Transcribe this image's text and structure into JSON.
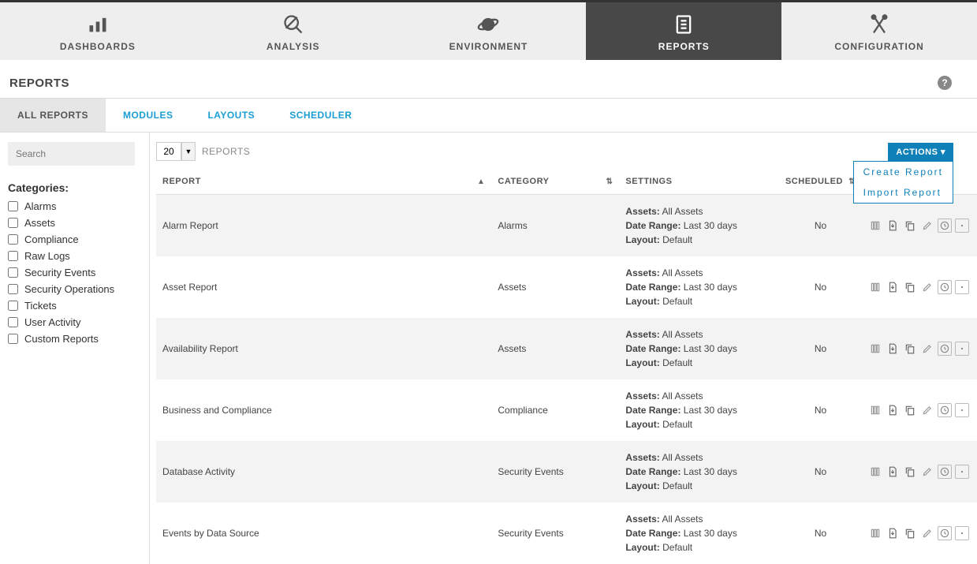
{
  "mainnav": {
    "items": [
      {
        "label": "DASHBOARDS"
      },
      {
        "label": "ANALYSIS"
      },
      {
        "label": "ENVIRONMENT"
      },
      {
        "label": "REPORTS"
      },
      {
        "label": "CONFIGURATION"
      }
    ],
    "active_index": 3
  },
  "page_title": "REPORTS",
  "help_glyph": "?",
  "subnav": {
    "items": [
      {
        "label": "ALL REPORTS"
      },
      {
        "label": "MODULES"
      },
      {
        "label": "LAYOUTS"
      },
      {
        "label": "SCHEDULER"
      }
    ],
    "active_index": 0
  },
  "sidebar": {
    "search_placeholder": "Search",
    "categories_title": "Categories:",
    "categories": [
      "Alarms",
      "Assets",
      "Compliance",
      "Raw Logs",
      "Security Events",
      "Security Operations",
      "Tickets",
      "User Activity",
      "Custom Reports"
    ]
  },
  "list_header": {
    "pagesize": "20",
    "label": "REPORTS",
    "actions_label": "ACTIONS ▾",
    "actions_menu": [
      "Create Report",
      "Import Report"
    ]
  },
  "table": {
    "columns": {
      "report": "REPORT",
      "category": "CATEGORY",
      "settings": "SETTINGS",
      "scheduled": "SCHEDULED"
    },
    "settings_labels": {
      "assets": "Assets:",
      "date_range": "Date Range:",
      "layout": "Layout:"
    },
    "rows": [
      {
        "report": "Alarm Report",
        "category": "Alarms",
        "assets": "All Assets",
        "date_range": "Last 30 days",
        "layout": "Default",
        "scheduled": "No"
      },
      {
        "report": "Asset Report",
        "category": "Assets",
        "assets": "All Assets",
        "date_range": "Last 30 days",
        "layout": "Default",
        "scheduled": "No"
      },
      {
        "report": "Availability Report",
        "category": "Assets",
        "assets": "All Assets",
        "date_range": "Last 30 days",
        "layout": "Default",
        "scheduled": "No"
      },
      {
        "report": "Business and Compliance",
        "category": "Compliance",
        "assets": "All Assets",
        "date_range": "Last 30 days",
        "layout": "Default",
        "scheduled": "No"
      },
      {
        "report": "Database Activity",
        "category": "Security Events",
        "assets": "All Assets",
        "date_range": "Last 30 days",
        "layout": "Default",
        "scheduled": "No"
      },
      {
        "report": "Events by Data Source",
        "category": "Security Events",
        "assets": "All Assets",
        "date_range": "Last 30 days",
        "layout": "Default",
        "scheduled": "No"
      }
    ]
  }
}
